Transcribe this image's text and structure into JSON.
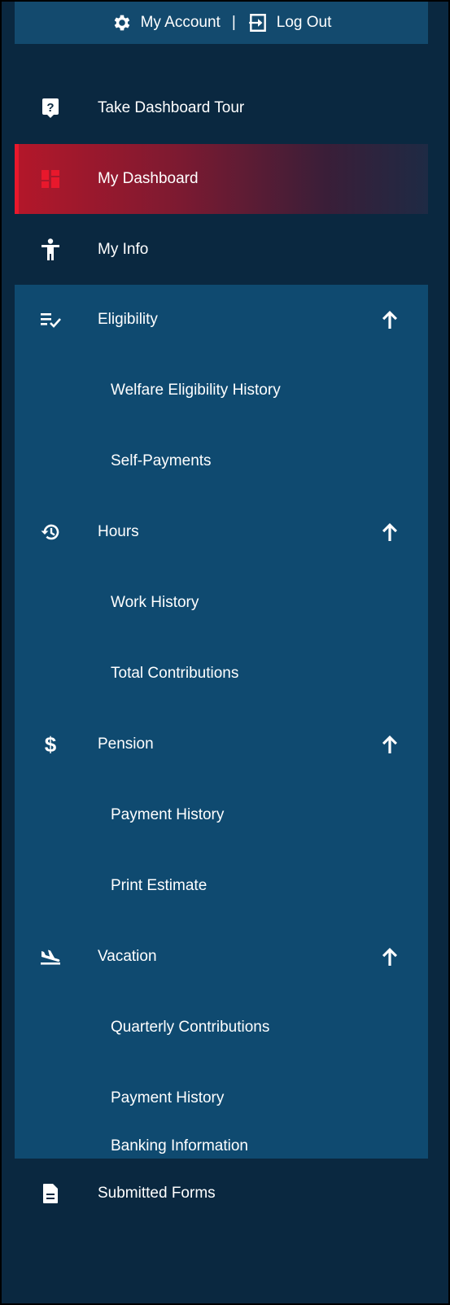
{
  "topbar": {
    "account_label": "My Account",
    "separator": "|",
    "logout_label": "Log Out"
  },
  "nav": {
    "tour": {
      "label": "Take Dashboard Tour",
      "icon": "help-icon"
    },
    "dashboard": {
      "label": "My Dashboard",
      "icon": "dashboard-icon"
    },
    "info": {
      "label": "My Info",
      "icon": "person-icon"
    },
    "eligibility": {
      "label": "Eligibility",
      "icon": "checklist-icon",
      "children": [
        "Welfare Eligibility History",
        "Self-Payments"
      ]
    },
    "hours": {
      "label": "Hours",
      "icon": "history-icon",
      "children": [
        "Work History",
        "Total Contributions"
      ]
    },
    "pension": {
      "label": "Pension",
      "icon": "dollar-icon",
      "children": [
        "Payment History",
        "Print Estimate"
      ]
    },
    "vacation": {
      "label": "Vacation",
      "icon": "flight-landing-icon",
      "children": [
        "Quarterly Contributions",
        "Payment History",
        "Banking Information"
      ]
    },
    "forms": {
      "label": "Submitted Forms",
      "icon": "document-icon"
    }
  },
  "colors": {
    "dark_navy": "#0a2840",
    "blue_section": "#0f4a70",
    "topbar": "#134a6e",
    "active_red": "#e8182c"
  }
}
